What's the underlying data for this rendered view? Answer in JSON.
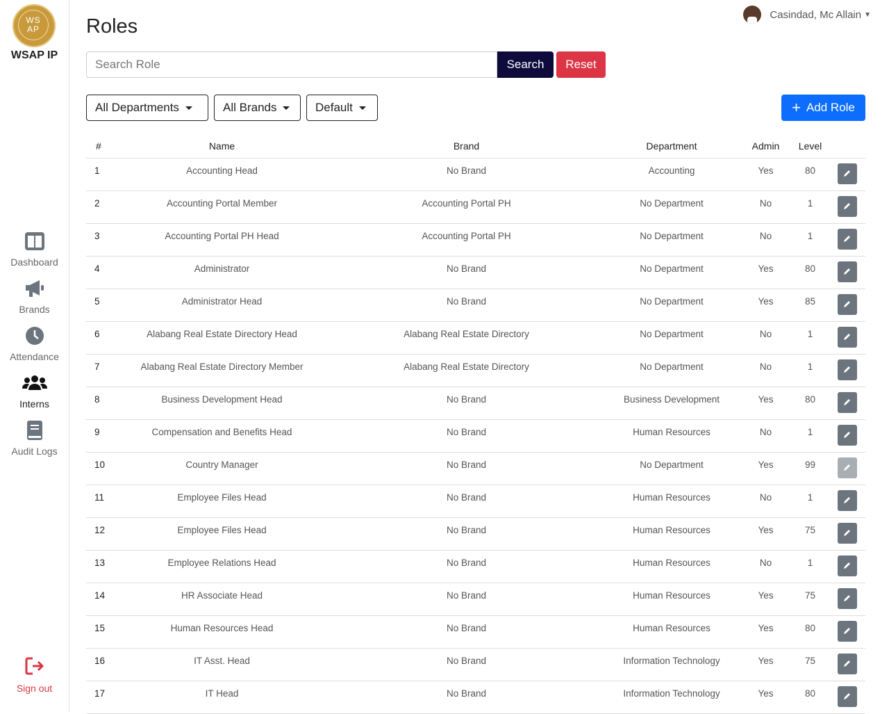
{
  "app": {
    "logo_text": "WS AP",
    "name": "WSAP IP"
  },
  "nav": [
    {
      "label": "Dashboard",
      "icon": "dashboard-icon"
    },
    {
      "label": "Brands",
      "icon": "megaphone-icon"
    },
    {
      "label": "Attendance",
      "icon": "clock-icon"
    },
    {
      "label": "Interns",
      "icon": "users-icon"
    },
    {
      "label": "Audit Logs",
      "icon": "book-icon"
    }
  ],
  "signout_label": "Sign out",
  "user": {
    "name": "Casindad, Mc Allain"
  },
  "page_title": "Roles",
  "search": {
    "placeholder": "Search Role",
    "button": "Search",
    "reset": "Reset"
  },
  "filters": {
    "department": "All Departments",
    "brand": "All Brands",
    "sort": "Default"
  },
  "add_button": "Add Role",
  "table": {
    "headers": [
      "#",
      "Name",
      "Brand",
      "Department",
      "Admin",
      "Level"
    ],
    "rows": [
      [
        "1",
        "Accounting Head",
        "No Brand",
        "Accounting",
        "Yes",
        "80"
      ],
      [
        "2",
        "Accounting Portal Member",
        "Accounting Portal PH",
        "No Department",
        "No",
        "1"
      ],
      [
        "3",
        "Accounting Portal PH Head",
        "Accounting Portal PH",
        "No Department",
        "No",
        "1"
      ],
      [
        "4",
        "Administrator",
        "No Brand",
        "No Department",
        "Yes",
        "80"
      ],
      [
        "5",
        "Administrator Head",
        "No Brand",
        "No Department",
        "Yes",
        "85"
      ],
      [
        "6",
        "Alabang Real Estate Directory Head",
        "Alabang Real Estate Directory",
        "No Department",
        "No",
        "1"
      ],
      [
        "7",
        "Alabang Real Estate Directory Member",
        "Alabang Real Estate Directory",
        "No Department",
        "No",
        "1"
      ],
      [
        "8",
        "Business Development Head",
        "No Brand",
        "Business Development",
        "Yes",
        "80"
      ],
      [
        "9",
        "Compensation and Benefits Head",
        "No Brand",
        "Human Resources",
        "No",
        "1"
      ],
      [
        "10",
        "Country Manager",
        "No Brand",
        "No Department",
        "Yes",
        "99"
      ],
      [
        "11",
        "Employee Files Head",
        "No Brand",
        "Human Resources",
        "No",
        "1"
      ],
      [
        "12",
        "Employee Files Head",
        "No Brand",
        "Human Resources",
        "Yes",
        "75"
      ],
      [
        "13",
        "Employee Relations Head",
        "No Brand",
        "Human Resources",
        "No",
        "1"
      ],
      [
        "14",
        "HR Associate Head",
        "No Brand",
        "Human Resources",
        "Yes",
        "75"
      ],
      [
        "15",
        "Human Resources Head",
        "No Brand",
        "Human Resources",
        "Yes",
        "80"
      ],
      [
        "16",
        "IT Asst. Head",
        "No Brand",
        "Information Technology",
        "Yes",
        "75"
      ],
      [
        "17",
        "IT Head",
        "No Brand",
        "Information Technology",
        "Yes",
        "80"
      ]
    ]
  }
}
